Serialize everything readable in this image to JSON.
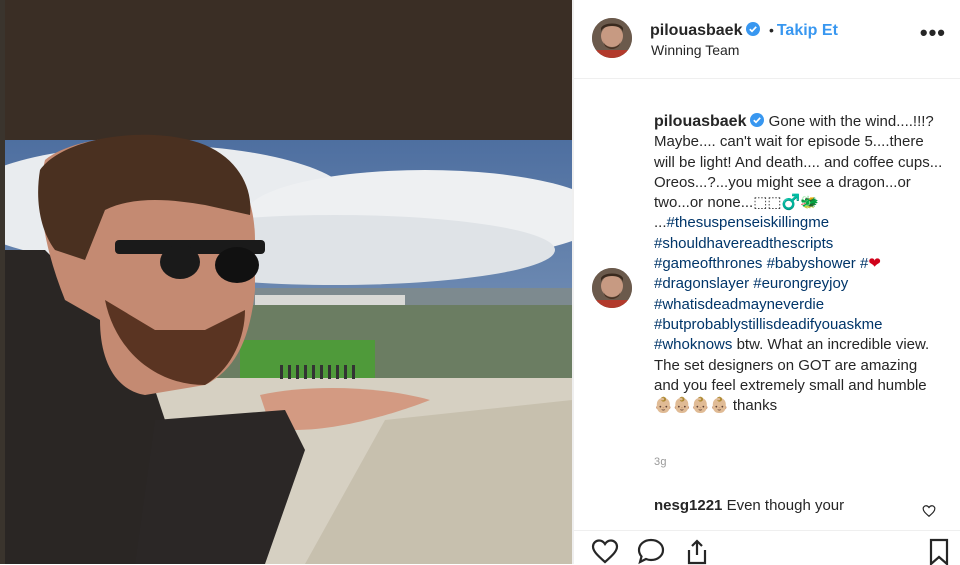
{
  "post": {
    "username": "pilouasbaek",
    "follow_label": "Takip Et",
    "separator": "•",
    "subtitle": "Winning Team",
    "more_label": "•••"
  },
  "caption": {
    "username": "pilouasbaek",
    "text_1": "Gone with the wind....!!!? Maybe.... can't wait for episode 5....there will be light! And death.... and coffee cups... Oreos...?...you might see a dragon...or two...or none...⬚⬚♂️🐲 ...",
    "tag_1": "#thesuspenseiskillingme",
    "tag_2": "#shouldhavereadthescripts",
    "tag_3": "#gameofthrones",
    "tag_4": "#babyshower",
    "tag_5": "#",
    "heart": "❤",
    "tag_6": "#dragonslayer",
    "tag_7": "#eurongreyjoy",
    "tag_8": "#whatisdeadmayneverdie",
    "tag_9": "#butprobablystillisdeadifyouaskme",
    "tag_10": "#whoknows",
    "text_2": "btw. What an incredible view. The set designers on GOT are amazing and you feel extremely small and humble",
    "emoji_tail": "👶🏼👶🏼👶🏼👶🏼",
    "text_3": "thanks",
    "age": "3g"
  },
  "comment": {
    "username": "nesg1221",
    "text": "Even though your"
  },
  "colors": {
    "link": "#3897f0",
    "hashtag": "#003569",
    "heart": "#d0021b"
  },
  "icons": [
    "like-icon",
    "comment-icon",
    "share-icon",
    "bookmark-icon",
    "verified-icon",
    "more-icon"
  ]
}
